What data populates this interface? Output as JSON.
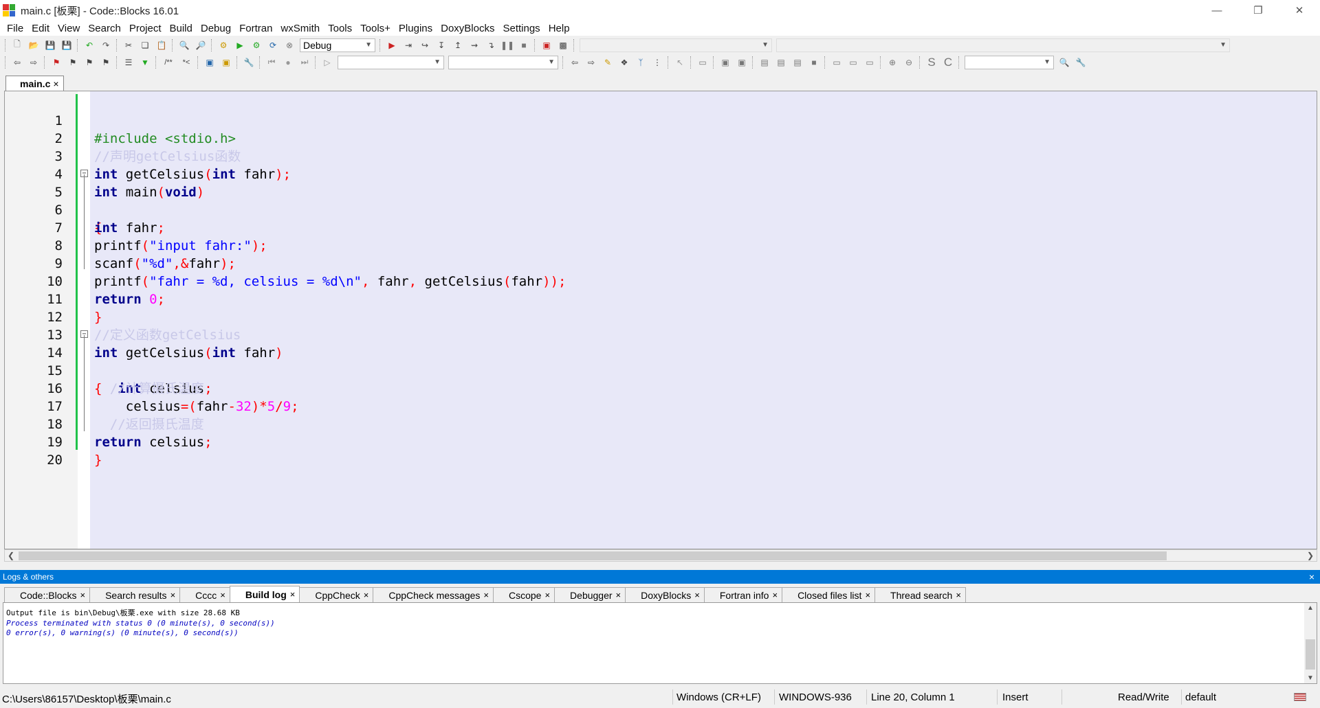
{
  "window": {
    "title": "main.c [板栗] - Code::Blocks 16.01",
    "controls": [
      "minimize-icon",
      "restore-icon",
      "close-icon"
    ]
  },
  "menu": [
    "File",
    "Edit",
    "View",
    "Search",
    "Project",
    "Build",
    "Debug",
    "Fortran",
    "wxSmith",
    "Tools",
    "Tools+",
    "Plugins",
    "DoxyBlocks",
    "Settings",
    "Help"
  ],
  "toolbar": {
    "build_target": "Debug",
    "comment_insert": "/**",
    "comment_line": "*<",
    "symbol_S": "S",
    "symbol_C": "C"
  },
  "editor": {
    "tab_label": "main.c",
    "tab_close": "×",
    "lines": [
      "1",
      "2",
      "3",
      "4",
      "5",
      "6",
      "7",
      "8",
      "9",
      "10",
      "11",
      "12",
      "13",
      "14",
      "15",
      "16",
      "17",
      "18",
      "19",
      "20"
    ],
    "code": {
      "l1": "#include <stdio.h>",
      "l2": "//声明getCelsius函数",
      "l12": "//定义函数getCelsius",
      "l15": "  //计算摄氏温度",
      "l17": "  //返回摄氏温度"
    },
    "fold_symbol": "−"
  },
  "logs": {
    "header": "Logs & others",
    "close": "×",
    "tabs": [
      {
        "label": "Code::Blocks",
        "active": false
      },
      {
        "label": "Search results",
        "active": false
      },
      {
        "label": "Cccc",
        "active": false
      },
      {
        "label": "Build log",
        "active": true
      },
      {
        "label": "CppCheck",
        "active": false
      },
      {
        "label": "CppCheck messages",
        "active": false
      },
      {
        "label": "Cscope",
        "active": false
      },
      {
        "label": "Debugger",
        "active": false
      },
      {
        "label": "DoxyBlocks",
        "active": false
      },
      {
        "label": "Fortran info",
        "active": false
      },
      {
        "label": "Closed files list",
        "active": false
      },
      {
        "label": "Thread search",
        "active": false
      }
    ],
    "lines": [
      "Output file is bin\\Debug\\板栗.exe with size 28.68 KB",
      "Process terminated with status 0 (0 minute(s), 0 second(s))",
      "0 error(s), 0 warning(s) (0 minute(s), 0 second(s))"
    ]
  },
  "status": {
    "path": "C:\\Users\\86157\\Desktop\\板栗\\main.c",
    "line_endings": "Windows (CR+LF)",
    "encoding": "WINDOWS-936",
    "position": "Line 20, Column 1",
    "mode": "Insert",
    "access": "Read/Write",
    "profile": "default"
  },
  "colors": {
    "keyword": "#00008b",
    "preprocessor": "#228b22",
    "comment": "#c8c8e8",
    "string": "#0000ff",
    "number": "#ff00ff",
    "operator": "#ff0000",
    "accent": "#0078d7",
    "changebar": "#21c24a"
  }
}
